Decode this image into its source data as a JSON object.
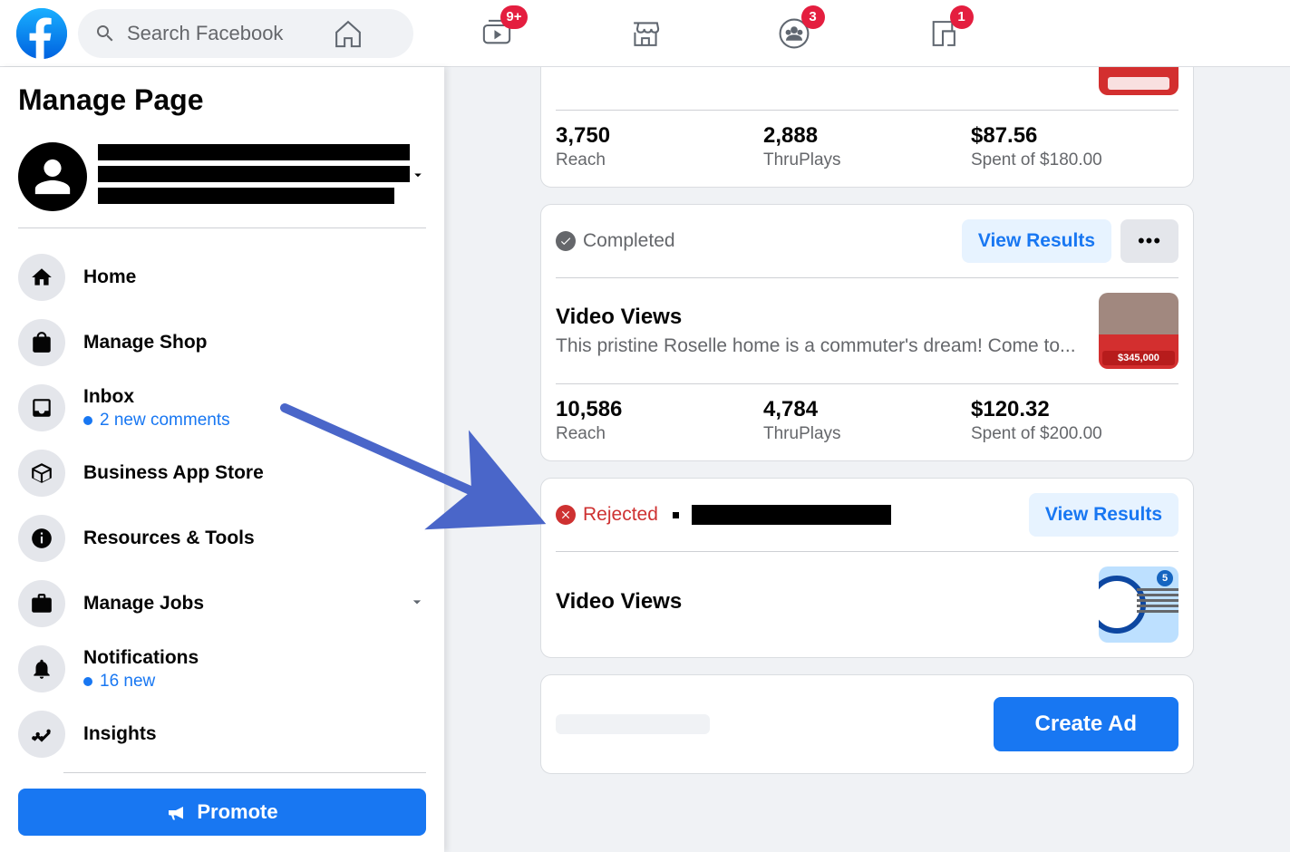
{
  "header": {
    "search_placeholder": "Search Facebook",
    "badges": {
      "watch": "9+",
      "groups": "3",
      "gaming": "1"
    }
  },
  "sidebar": {
    "title": "Manage Page",
    "items": [
      {
        "label": "Home"
      },
      {
        "label": "Manage Shop"
      },
      {
        "label": "Inbox",
        "sub": "2 new comments",
        "sub_style": "blue"
      },
      {
        "label": "Business App Store"
      },
      {
        "label": "Resources & Tools"
      },
      {
        "label": "Manage Jobs",
        "chevron": true
      },
      {
        "label": "Notifications",
        "sub": "16 new",
        "sub_style": "blue"
      },
      {
        "label": "Insights"
      }
    ],
    "promote_label": "Promote"
  },
  "ads": [
    {
      "reach": "3,750",
      "thruplays": "2,888",
      "spent": "$87.56",
      "budget": "Spent of $180.00"
    },
    {
      "status": "Completed",
      "view_label": "View Results",
      "title": "Video Views",
      "desc": "This pristine Roselle home is a commuter's dream! Come to...",
      "thumb_price": "$345,000",
      "reach": "10,586",
      "thruplays": "4,784",
      "spent": "$120.32",
      "budget": "Spent of $200.00"
    },
    {
      "status": "Rejected",
      "view_label": "View Results",
      "title": "Video Views"
    }
  ],
  "labels": {
    "reach": "Reach",
    "thruplays": "ThruPlays",
    "create_ad": "Create Ad"
  }
}
